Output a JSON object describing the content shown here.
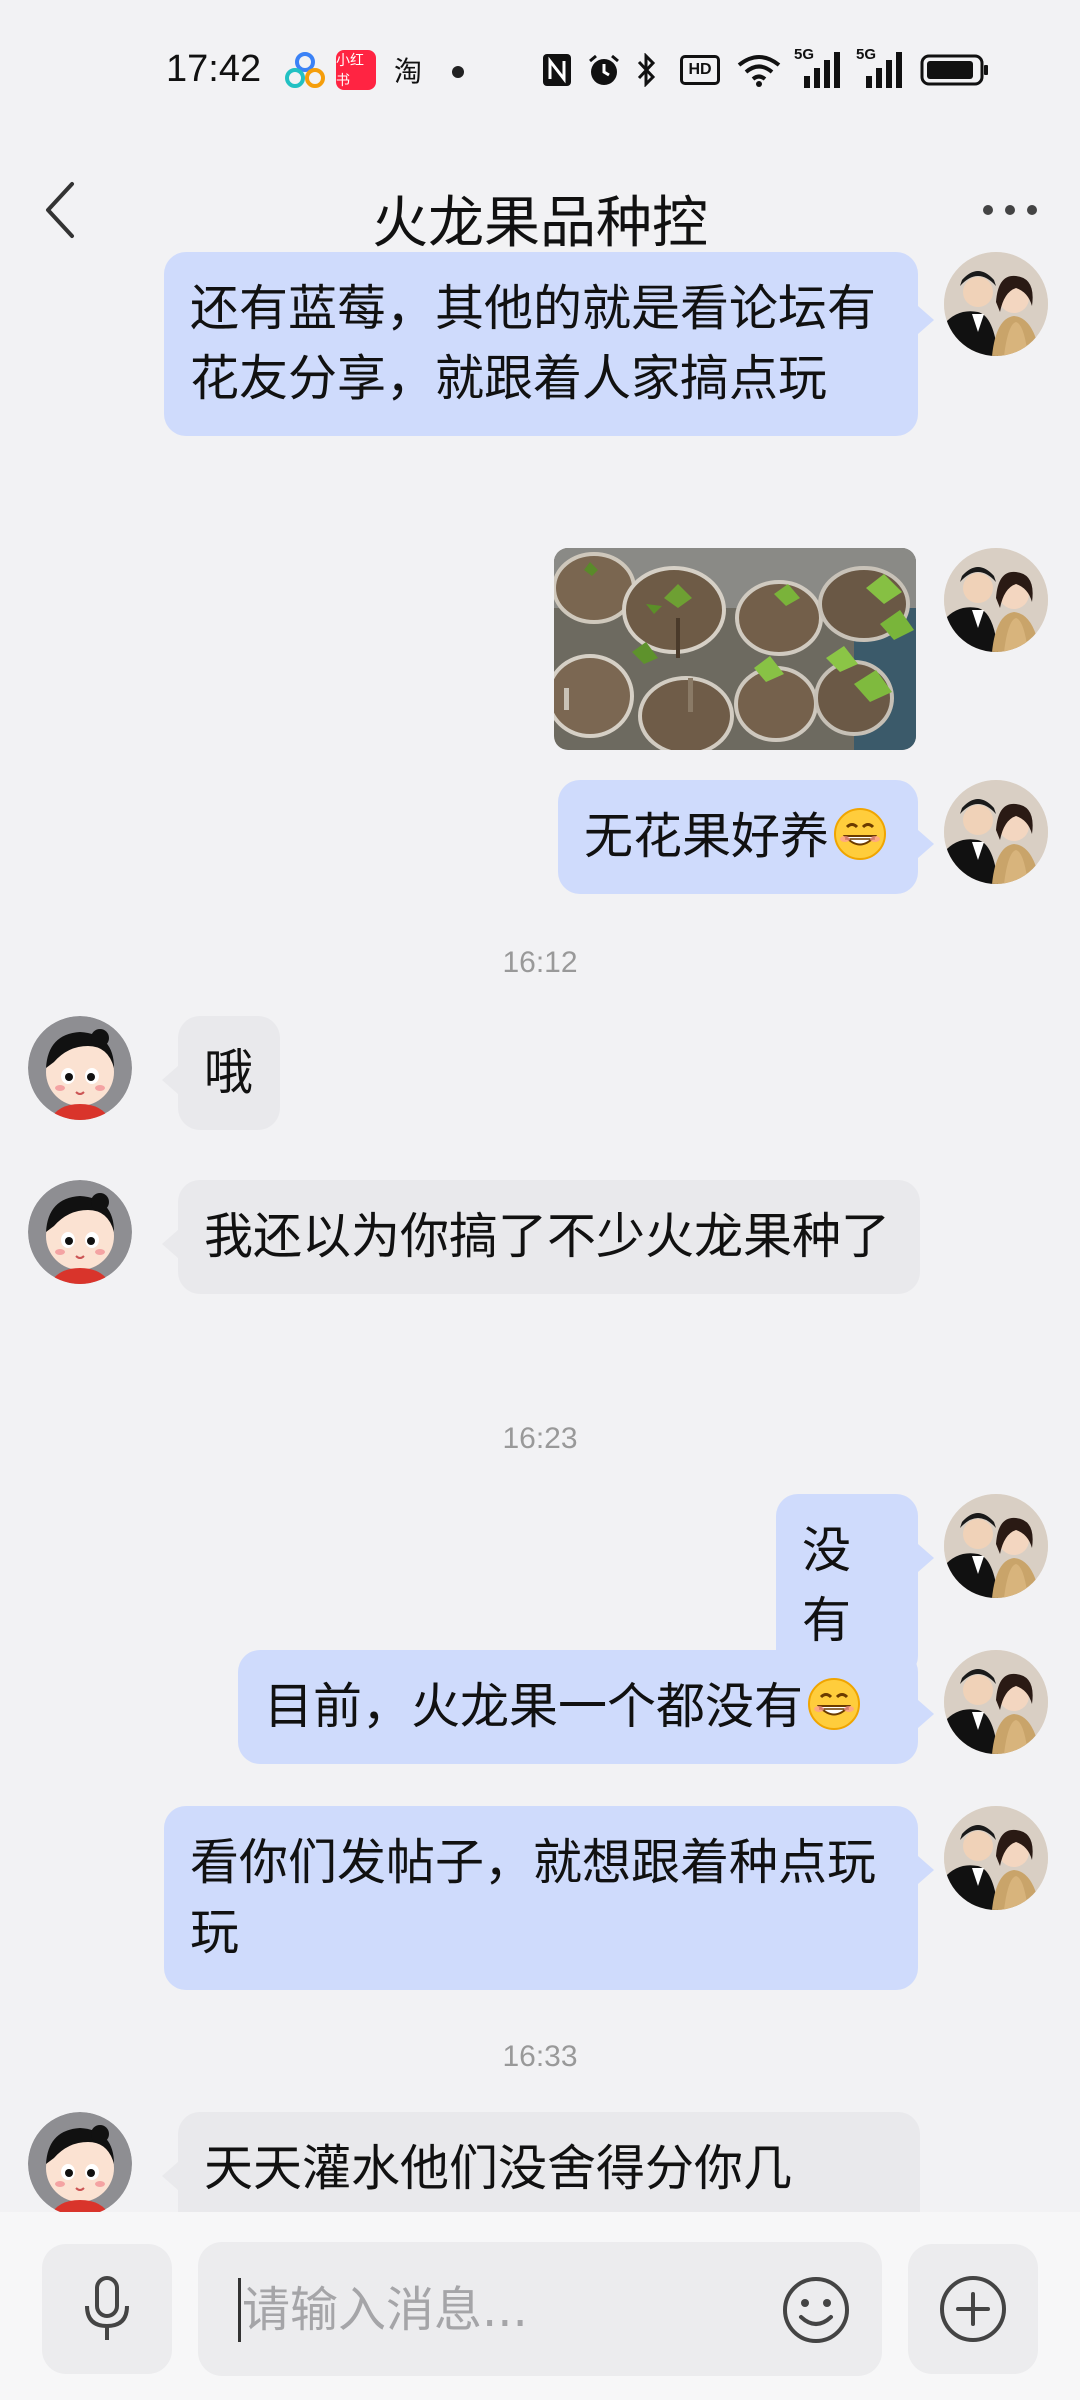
{
  "status_bar": {
    "time": "17:42",
    "app_icons": [
      "cloud-app-icon",
      "xiaohongshu-icon",
      "taobao-icon"
    ],
    "xiaohongshu_label": "小红书",
    "taobao_label": "淘",
    "system_icons": [
      "nfc-icon",
      "alarm-icon",
      "bluetooth-icon",
      "hd-icon",
      "wifi-icon",
      "signal-5g-icon",
      "signal-5g-icon",
      "battery-icon"
    ],
    "hd_label": "HD",
    "network_label": "5G"
  },
  "nav": {
    "title": "火龙果品种控",
    "back_icon": "chevron-left-icon",
    "more_icon": "more-dots-icon"
  },
  "messages": [
    {
      "side": "out",
      "type": "text",
      "text": "还有蓝莓，其他的就是看论坛有花友分享，就跟着人家搞点玩"
    },
    {
      "side": "out",
      "type": "image",
      "image_desc": "potted fig seedlings"
    },
    {
      "side": "out",
      "type": "text",
      "text": "无花果好养",
      "emoji": "grin-emoji"
    },
    {
      "type": "timestamp",
      "text": "16:12"
    },
    {
      "side": "in",
      "type": "text",
      "text": "哦"
    },
    {
      "side": "in",
      "type": "text",
      "text": "我还以为你搞了不少火龙果种了"
    },
    {
      "type": "timestamp",
      "text": "16:23"
    },
    {
      "side": "out",
      "type": "text",
      "text": "没有"
    },
    {
      "side": "out",
      "type": "text",
      "text": "目前，火龙果一个都没有",
      "emoji": "grin-emoji"
    },
    {
      "side": "out",
      "type": "text",
      "text": "看你们发帖子，就想跟着种点玩玩"
    },
    {
      "type": "timestamp",
      "text": "16:33"
    },
    {
      "side": "in",
      "type": "text",
      "text": "天天灌水他们没舍得分你几"
    }
  ],
  "input_bar": {
    "placeholder": "请输入消息...",
    "mic_icon": "microphone-icon",
    "emoji_icon": "smiley-icon",
    "plus_icon": "plus-circle-icon"
  },
  "colors": {
    "background": "#f2f2f4",
    "outgoing_bubble": "#cfdbfc",
    "incoming_bubble": "#e9e9ec",
    "timestamp": "#999999",
    "xiaohongshu_red": "#ff2442"
  }
}
